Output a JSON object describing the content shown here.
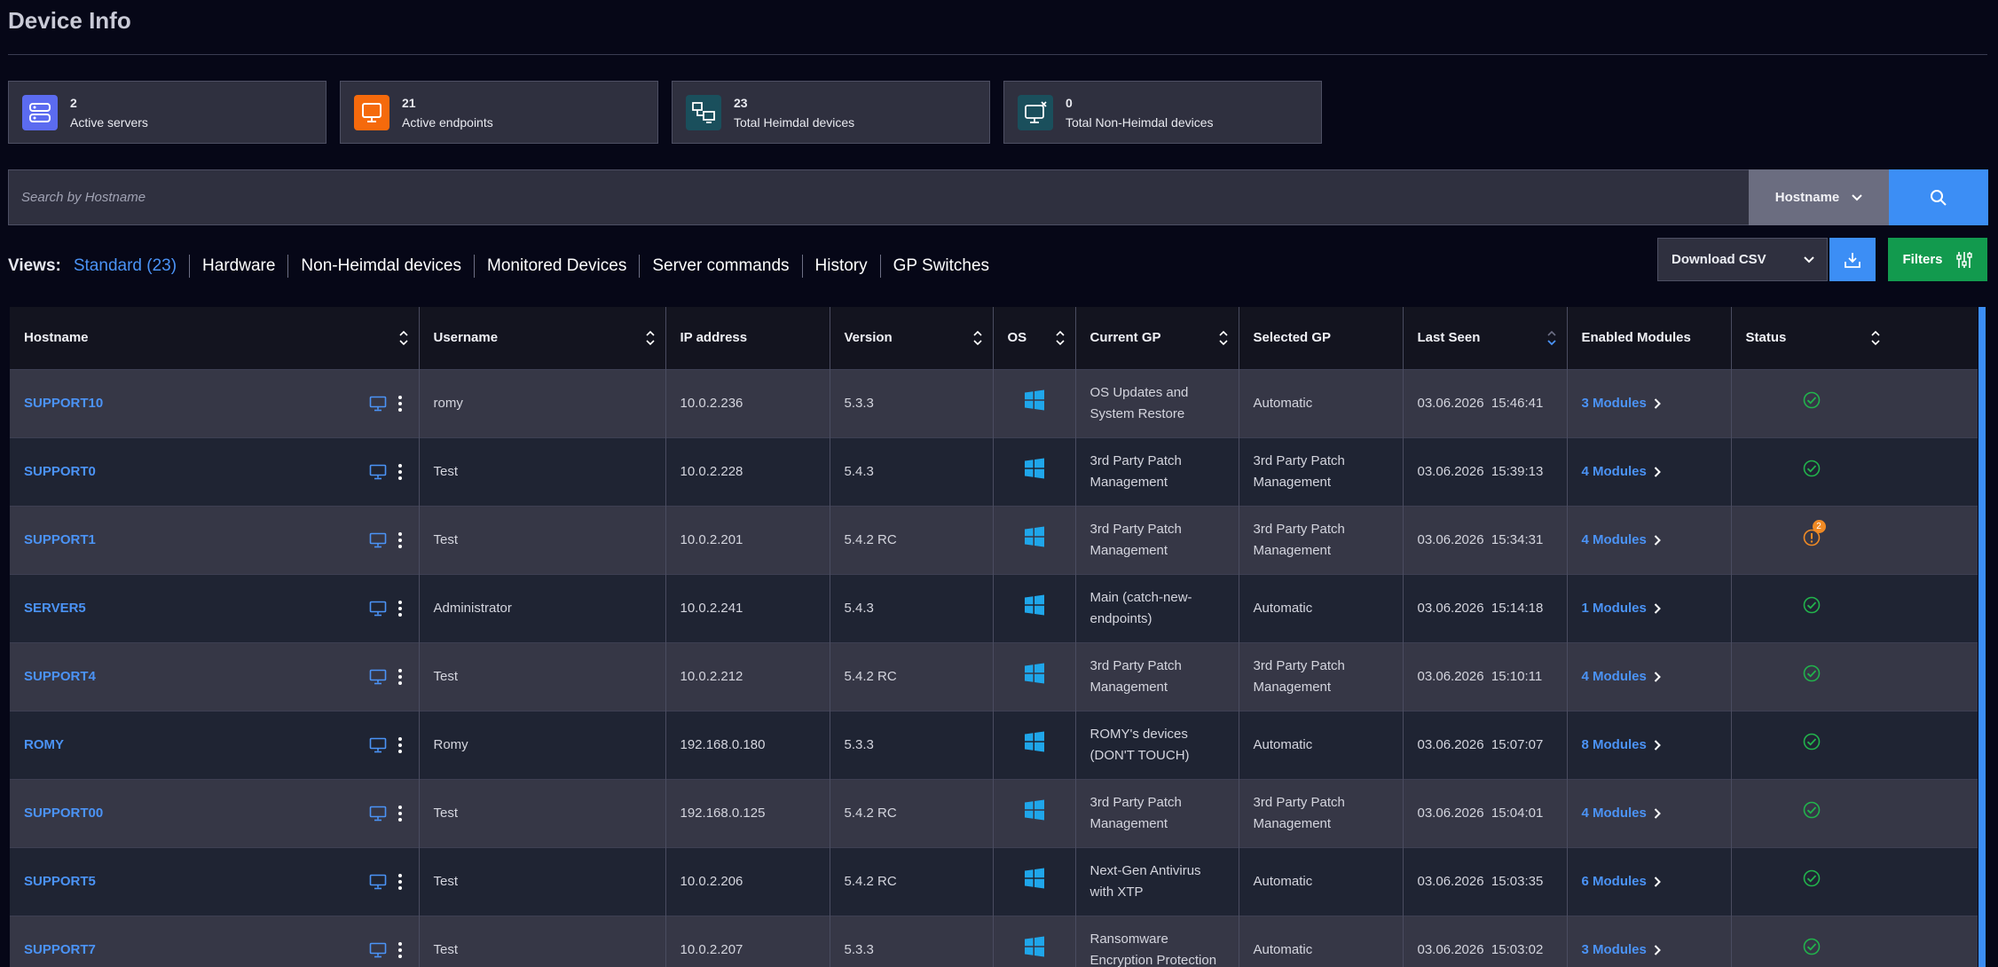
{
  "page": {
    "title": "Device Info"
  },
  "cards": [
    {
      "value": "2",
      "label": "Active servers",
      "color": "#5b6bf0",
      "icon": "server-icon"
    },
    {
      "value": "21",
      "label": "Active endpoints",
      "color": "#f56a0c",
      "icon": "monitor-icon"
    },
    {
      "value": "23",
      "label": "Total Heimdal devices",
      "color": "#1a4f5c",
      "icon": "devices-icon"
    },
    {
      "value": "0",
      "label": "Total Non-Heimdal devices",
      "color": "#1a4f5c",
      "icon": "monitor-x-icon"
    }
  ],
  "search": {
    "placeholder": "Search by Hostname",
    "field": "Hostname"
  },
  "views": {
    "label": "Views:",
    "tabs": [
      "Standard (23)",
      "Hardware",
      "Non-Heimdal devices",
      "Monitored Devices",
      "Server commands",
      "History",
      "GP Switches"
    ]
  },
  "toolbar": {
    "download_label": "Download CSV",
    "filters_label": "Filters"
  },
  "table": {
    "columns": [
      "Hostname",
      "Username",
      "IP address",
      "Version",
      "OS",
      "Current GP",
      "Selected GP",
      "Last Seen",
      "Enabled Modules",
      "Status"
    ],
    "rows": [
      {
        "hostname": "SUPPORT10",
        "username": "romy",
        "ip": "10.0.2.236",
        "version": "5.3.3",
        "current_gp": "OS Updates and System Restore",
        "selected_gp": "Automatic",
        "last_seen": "03.06.2026  15:46:41",
        "modules": "3 Modules",
        "status": "ok"
      },
      {
        "hostname": "SUPPORT0",
        "username": "Test",
        "ip": "10.0.2.228",
        "version": "5.4.3",
        "current_gp": "3rd Party Patch Management",
        "selected_gp": "3rd Party Patch Management",
        "last_seen": "03.06.2026  15:39:13",
        "modules": "4 Modules",
        "status": "ok"
      },
      {
        "hostname": "SUPPORT1",
        "username": "Test",
        "ip": "10.0.2.201",
        "version": "5.4.2 RC",
        "current_gp": "3rd Party Patch Management",
        "selected_gp": "3rd Party Patch Management",
        "last_seen": "03.06.2026  15:34:31",
        "modules": "4 Modules",
        "status": "warning",
        "badge": "2"
      },
      {
        "hostname": "SERVER5",
        "username": "Administrator",
        "ip": "10.0.2.241",
        "version": "5.4.3",
        "current_gp": "Main (catch-new-endpoints)",
        "selected_gp": "Automatic",
        "last_seen": "03.06.2026  15:14:18",
        "modules": "1 Modules",
        "status": "ok"
      },
      {
        "hostname": "SUPPORT4",
        "username": "Test",
        "ip": "10.0.2.212",
        "version": "5.4.2 RC",
        "current_gp": "3rd Party Patch Management",
        "selected_gp": "3rd Party Patch Management",
        "last_seen": "03.06.2026  15:10:11",
        "modules": "4 Modules",
        "status": "ok"
      },
      {
        "hostname": "ROMY",
        "username": "Romy",
        "ip": "192.168.0.180",
        "version": "5.3.3",
        "current_gp": "ROMY's devices (DON'T TOUCH)",
        "selected_gp": "Automatic",
        "last_seen": "03.06.2026  15:07:07",
        "modules": "8 Modules",
        "status": "ok"
      },
      {
        "hostname": "SUPPORT00",
        "username": "Test",
        "ip": "192.168.0.125",
        "version": "5.4.2 RC",
        "current_gp": "3rd Party Patch Management",
        "selected_gp": "3rd Party Patch Management",
        "last_seen": "03.06.2026  15:04:01",
        "modules": "4 Modules",
        "status": "ok"
      },
      {
        "hostname": "SUPPORT5",
        "username": "Test",
        "ip": "10.0.2.206",
        "version": "5.4.2 RC",
        "current_gp": "Next-Gen Antivirus with XTP",
        "selected_gp": "Automatic",
        "last_seen": "03.06.2026  15:03:35",
        "modules": "6 Modules",
        "status": "ok"
      },
      {
        "hostname": "SUPPORT7",
        "username": "Test",
        "ip": "10.0.2.207",
        "version": "5.3.3",
        "current_gp": "Ransomware Encryption Protection",
        "selected_gp": "Automatic",
        "last_seen": "03.06.2026  15:03:02",
        "modules": "3 Modules",
        "status": "ok"
      }
    ]
  },
  "colors": {
    "accent": "#4b93f6",
    "ok": "#22b24c",
    "warning": "#f08a24",
    "windows": "#1fa6ea"
  }
}
